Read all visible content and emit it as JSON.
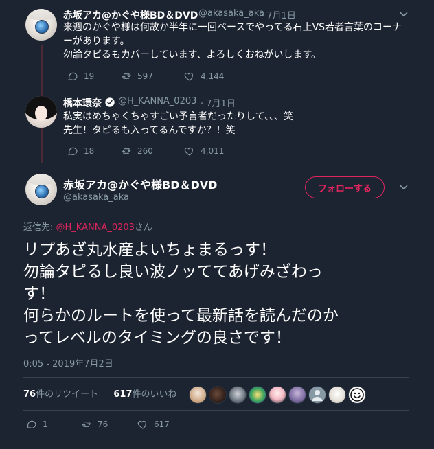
{
  "thread": [
    {
      "name": "赤坂アカ@かぐや様BD＆DVD",
      "handle": "@akasaka_aka",
      "date": "7月1日",
      "text_lines": [
        "来週のかぐや様は何故か半年に一回ペースでやってる石上VS若者言葉のコーナ",
        "ーがあります。",
        "勿論タピるもカバーしています、よろしくおねがいします。"
      ],
      "replies": "19",
      "retweets": "597",
      "likes": "4,144"
    },
    {
      "name": "橋本環奈",
      "handle": "@H_KANNA_0203",
      "date": "7月1日",
      "text_lines": [
        "私実はめちゃくちゃすごい予言者だったりして、、、笑",
        "先生！タピるも入ってるんですか？！笑"
      ],
      "replies": "18",
      "retweets": "260",
      "likes": "4,011"
    }
  ],
  "main": {
    "name": "赤坂アカ@かぐや様BD＆DVD",
    "handle": "@akasaka_aka",
    "follow_label": "フォローする",
    "reply_prefix": "返信先: ",
    "reply_to": "@H_KANNA_0203",
    "reply_suffix": "さん",
    "text_lines": [
      "リプあざ丸水産よいちょまるっす！",
      "勿論タピるし良い波ノッててあげみざわっ",
      "す！",
      "何らかのルートを使って最新話を読んだのか",
      "ってレベルのタイミングの良さです！"
    ],
    "timestamp": "0:05 - 2019年7月2日",
    "retweet_count": "76",
    "retweet_label": "件のリツイート",
    "like_count": "617",
    "like_label": "件のいいね",
    "replies": "1",
    "retweets": "76",
    "likes": "617"
  },
  "colors": {
    "background": "#1c2431",
    "muted": "#8899a6",
    "accent": "#e0245e",
    "verified": "#ffffff"
  },
  "icons": [
    "chevron-down-icon",
    "reply-icon",
    "retweet-icon",
    "like-icon",
    "verified-badge-icon",
    "smiley-icon"
  ]
}
